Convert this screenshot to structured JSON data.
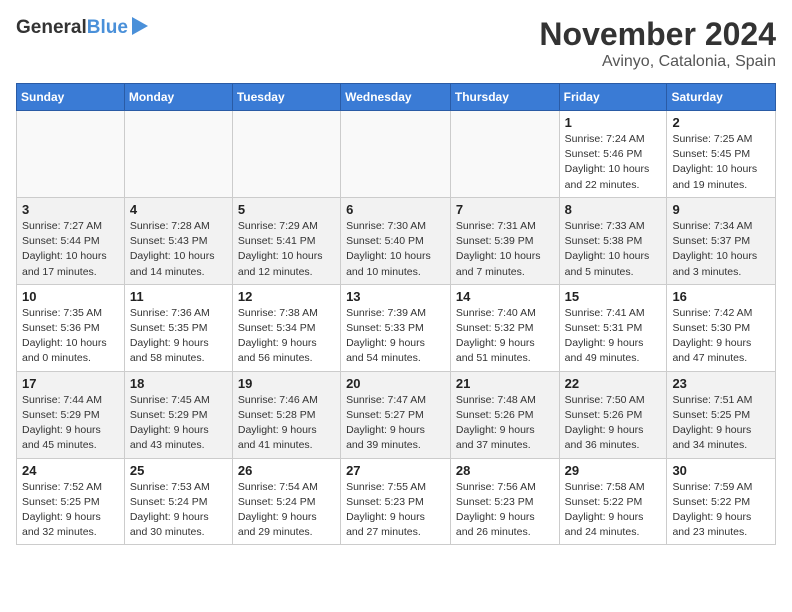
{
  "logo": {
    "line1": "General",
    "line2": "Blue"
  },
  "title": "November 2024",
  "location": "Avinyo, Catalonia, Spain",
  "weekdays": [
    "Sunday",
    "Monday",
    "Tuesday",
    "Wednesday",
    "Thursday",
    "Friday",
    "Saturday"
  ],
  "weeks": [
    [
      {
        "day": "",
        "info": ""
      },
      {
        "day": "",
        "info": ""
      },
      {
        "day": "",
        "info": ""
      },
      {
        "day": "",
        "info": ""
      },
      {
        "day": "",
        "info": ""
      },
      {
        "day": "1",
        "info": "Sunrise: 7:24 AM\nSunset: 5:46 PM\nDaylight: 10 hours and 22 minutes."
      },
      {
        "day": "2",
        "info": "Sunrise: 7:25 AM\nSunset: 5:45 PM\nDaylight: 10 hours and 19 minutes."
      }
    ],
    [
      {
        "day": "3",
        "info": "Sunrise: 7:27 AM\nSunset: 5:44 PM\nDaylight: 10 hours and 17 minutes."
      },
      {
        "day": "4",
        "info": "Sunrise: 7:28 AM\nSunset: 5:43 PM\nDaylight: 10 hours and 14 minutes."
      },
      {
        "day": "5",
        "info": "Sunrise: 7:29 AM\nSunset: 5:41 PM\nDaylight: 10 hours and 12 minutes."
      },
      {
        "day": "6",
        "info": "Sunrise: 7:30 AM\nSunset: 5:40 PM\nDaylight: 10 hours and 10 minutes."
      },
      {
        "day": "7",
        "info": "Sunrise: 7:31 AM\nSunset: 5:39 PM\nDaylight: 10 hours and 7 minutes."
      },
      {
        "day": "8",
        "info": "Sunrise: 7:33 AM\nSunset: 5:38 PM\nDaylight: 10 hours and 5 minutes."
      },
      {
        "day": "9",
        "info": "Sunrise: 7:34 AM\nSunset: 5:37 PM\nDaylight: 10 hours and 3 minutes."
      }
    ],
    [
      {
        "day": "10",
        "info": "Sunrise: 7:35 AM\nSunset: 5:36 PM\nDaylight: 10 hours and 0 minutes."
      },
      {
        "day": "11",
        "info": "Sunrise: 7:36 AM\nSunset: 5:35 PM\nDaylight: 9 hours and 58 minutes."
      },
      {
        "day": "12",
        "info": "Sunrise: 7:38 AM\nSunset: 5:34 PM\nDaylight: 9 hours and 56 minutes."
      },
      {
        "day": "13",
        "info": "Sunrise: 7:39 AM\nSunset: 5:33 PM\nDaylight: 9 hours and 54 minutes."
      },
      {
        "day": "14",
        "info": "Sunrise: 7:40 AM\nSunset: 5:32 PM\nDaylight: 9 hours and 51 minutes."
      },
      {
        "day": "15",
        "info": "Sunrise: 7:41 AM\nSunset: 5:31 PM\nDaylight: 9 hours and 49 minutes."
      },
      {
        "day": "16",
        "info": "Sunrise: 7:42 AM\nSunset: 5:30 PM\nDaylight: 9 hours and 47 minutes."
      }
    ],
    [
      {
        "day": "17",
        "info": "Sunrise: 7:44 AM\nSunset: 5:29 PM\nDaylight: 9 hours and 45 minutes."
      },
      {
        "day": "18",
        "info": "Sunrise: 7:45 AM\nSunset: 5:29 PM\nDaylight: 9 hours and 43 minutes."
      },
      {
        "day": "19",
        "info": "Sunrise: 7:46 AM\nSunset: 5:28 PM\nDaylight: 9 hours and 41 minutes."
      },
      {
        "day": "20",
        "info": "Sunrise: 7:47 AM\nSunset: 5:27 PM\nDaylight: 9 hours and 39 minutes."
      },
      {
        "day": "21",
        "info": "Sunrise: 7:48 AM\nSunset: 5:26 PM\nDaylight: 9 hours and 37 minutes."
      },
      {
        "day": "22",
        "info": "Sunrise: 7:50 AM\nSunset: 5:26 PM\nDaylight: 9 hours and 36 minutes."
      },
      {
        "day": "23",
        "info": "Sunrise: 7:51 AM\nSunset: 5:25 PM\nDaylight: 9 hours and 34 minutes."
      }
    ],
    [
      {
        "day": "24",
        "info": "Sunrise: 7:52 AM\nSunset: 5:25 PM\nDaylight: 9 hours and 32 minutes."
      },
      {
        "day": "25",
        "info": "Sunrise: 7:53 AM\nSunset: 5:24 PM\nDaylight: 9 hours and 30 minutes."
      },
      {
        "day": "26",
        "info": "Sunrise: 7:54 AM\nSunset: 5:24 PM\nDaylight: 9 hours and 29 minutes."
      },
      {
        "day": "27",
        "info": "Sunrise: 7:55 AM\nSunset: 5:23 PM\nDaylight: 9 hours and 27 minutes."
      },
      {
        "day": "28",
        "info": "Sunrise: 7:56 AM\nSunset: 5:23 PM\nDaylight: 9 hours and 26 minutes."
      },
      {
        "day": "29",
        "info": "Sunrise: 7:58 AM\nSunset: 5:22 PM\nDaylight: 9 hours and 24 minutes."
      },
      {
        "day": "30",
        "info": "Sunrise: 7:59 AM\nSunset: 5:22 PM\nDaylight: 9 hours and 23 minutes."
      }
    ]
  ]
}
